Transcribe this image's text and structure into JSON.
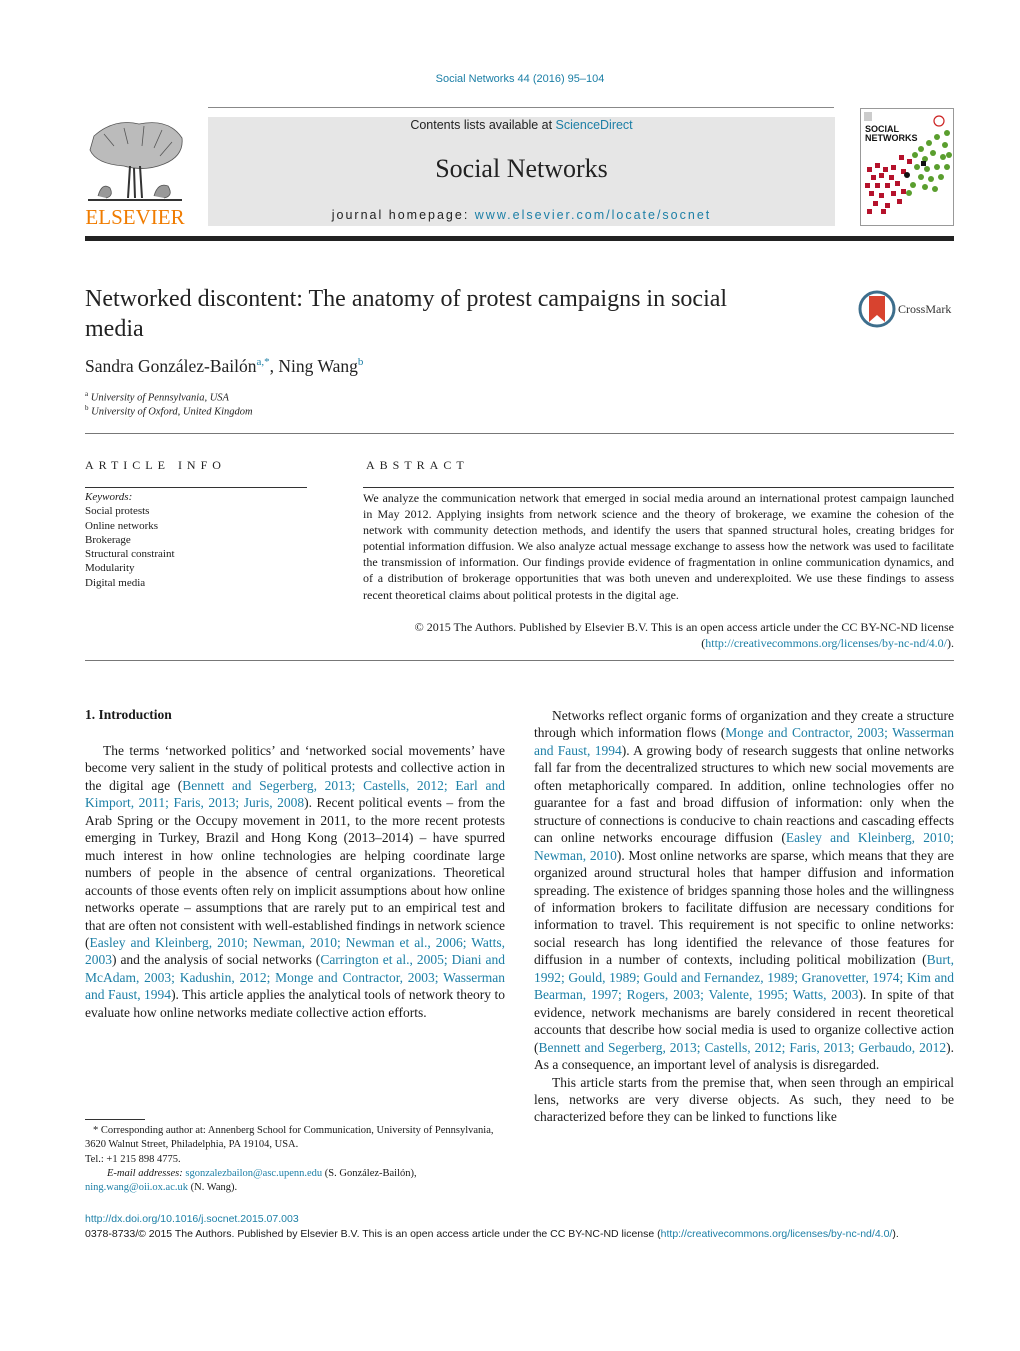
{
  "header": {
    "journal_ref": "Social Networks 44 (2016) 95–104",
    "contents_prefix": "Contents lists available at ",
    "contents_link": "ScienceDirect",
    "journal_title": "Social Networks",
    "homepage_prefix": "journal homepage: ",
    "homepage_link": "www.elsevier.com/locate/socnet",
    "publisher_logo": "ELSEVIER",
    "cover_title_line1": "SOCIAL",
    "cover_title_line2": "NETWORKS",
    "crossmark_label": "CrossMark"
  },
  "article": {
    "title": "Networked discontent: The anatomy of protest campaigns in social media",
    "authors": [
      {
        "name": "Sandra González-Bailón",
        "sup": "a,*"
      },
      {
        "name": "Ning Wang",
        "sup": "b"
      }
    ],
    "author_separator": ", ",
    "affiliations": [
      {
        "sup": "a",
        "text": "University of Pennsylvania, USA"
      },
      {
        "sup": "b",
        "text": "University of Oxford, United Kingdom"
      }
    ]
  },
  "article_info": {
    "heading": "ARTICLE INFO",
    "keywords_label": "Keywords:",
    "keywords": [
      "Social protests",
      "Online networks",
      "Brokerage",
      "Structural constraint",
      "Modularity",
      "Digital media"
    ]
  },
  "abstract": {
    "heading": "ABSTRACT",
    "text": "We analyze the communication network that emerged in social media around an international protest campaign launched in May 2012. Applying insights from network science and the theory of brokerage, we examine the cohesion of the network with community detection methods, and identify the users that spanned structural holes, creating bridges for potential information diffusion. We also analyze actual message exchange to assess how the network was used to facilitate the transmission of information. Our findings provide evidence of fragmentation in online communication dynamics, and of a distribution of brokerage opportunities that was both uneven and underexploited. We use these findings to assess recent theoretical claims about political protests in the digital age.",
    "copyright": "© 2015 The Authors. Published by Elsevier B.V. This is an open access article under the CC BY-NC-ND license (",
    "license_link": "http://creativecommons.org/licenses/by-nc-nd/4.0/",
    "copyright_end": ")."
  },
  "intro": {
    "heading": "1.  Introduction",
    "left_p1": [
      {
        "t": "The terms ‘networked politics’ and ‘networked social movements’ have become very salient in the study of political protests and collective action in the digital age ("
      },
      {
        "l": "Bennett and Segerberg, 2013; Castells, 2012; Earl and Kimport, 2011; Faris, 2013; Juris, 2008"
      },
      {
        "t": "). Recent political events – from the Arab Spring or the Occupy movement in 2011, to the more recent protests emerging in Turkey, Brazil and Hong Kong (2013–2014) – have spurred much interest in how online technologies are helping coordinate large numbers of people in the absence of central organizations. Theoretical accounts of those events often rely on implicit assumptions about how online networks operate – assumptions that are rarely put to an empirical test and that are often not consistent with well-established findings in network science ("
      },
      {
        "l": "Easley and Kleinberg, 2010; Newman, 2010; Newman et al., 2006; Watts, 2003"
      },
      {
        "t": ") and the analysis of social networks ("
      },
      {
        "l": "Carrington et al., 2005; Diani and McAdam, 2003; Kadushin, 2012; Monge and Contractor, 2003; Wasserman and Faust, 1994"
      },
      {
        "t": "). This article applies the analytical tools of network theory to evaluate how online networks mediate collective action efforts."
      }
    ],
    "right_p1": [
      {
        "t": "Networks reflect organic forms of organization and they create a structure through which information flows ("
      },
      {
        "l": "Monge and Contractor, 2003; Wasserman and Faust, 1994"
      },
      {
        "t": "). A growing body of research suggests that online networks fall far from the decentralized structures to which new social movements are often metaphorically compared. In addition, online technologies offer no guarantee for a fast and broad diffusion of information: only when the structure of connections is conducive to chain reactions and cascading effects can online networks encourage diffusion ("
      },
      {
        "l": "Easley and Kleinberg, 2010; Newman, 2010"
      },
      {
        "t": "). Most online networks are sparse, which means that they are organized around structural holes that hamper diffusion and information spreading. The existence of bridges spanning those holes and the willingness of information brokers to facilitate diffusion are necessary conditions for information to travel. This requirement is not specific to online networks: social research has long identified the relevance of those features for diffusion in a number of contexts, including political mobilization ("
      },
      {
        "l": "Burt, 1992; Gould, 1989; Gould and Fernandez, 1989; Granovetter, 1974; Kim and Bearman, 1997; Rogers, 2003; Valente, 1995; Watts, 2003"
      },
      {
        "t": "). In spite of that evidence, network mechanisms are barely considered in recent theoretical accounts that describe how social media is used to organize collective action ("
      },
      {
        "l": "Bennett and Segerberg, 2013; Castells, 2012; Faris, 2013; Gerbaudo, 2012"
      },
      {
        "t": "). As a consequence, an important level of analysis is disregarded."
      }
    ],
    "right_p2": "This article starts from the premise that, when seen through an empirical lens, networks are very diverse objects. As such, they need to be characterized before they can be linked to functions like"
  },
  "footnote": {
    "corresponding": "* Corresponding author at: Annenberg School for Communication, University of Pennsylvania, 3620 Walnut Street, Philadelphia, PA 19104, USA.",
    "tel": "Tel.: +1 215 898 4775.",
    "email_label": "E-mail addresses: ",
    "email1": "sgonzalezbailon@asc.upenn.edu",
    "email1_name": " (S. González-Bailón),",
    "email2": "ning.wang@oii.ox.ac.uk",
    "email2_name": " (N. Wang)."
  },
  "footer": {
    "doi": "http://dx.doi.org/10.1016/j.socnet.2015.07.003",
    "copyright": "0378-8733/© 2015 The Authors. Published by Elsevier B.V. This is an open access article under the CC BY-NC-ND license (",
    "license_link": "http://creativecommons.org/licenses/by-nc-nd/4.0/",
    "copyright_end": ")."
  }
}
